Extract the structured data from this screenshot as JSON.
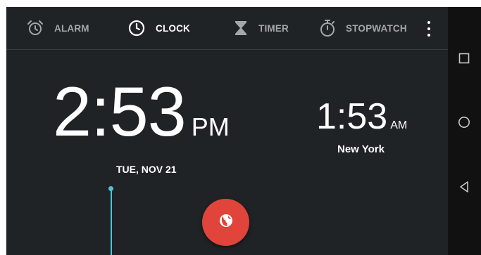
{
  "tabs": [
    {
      "label": "ALARM",
      "icon": "alarm-clock-icon",
      "active": false
    },
    {
      "label": "CLOCK",
      "icon": "clock-icon",
      "active": true
    },
    {
      "label": "TIMER",
      "icon": "hourglass-icon",
      "active": false
    },
    {
      "label": "STOPWATCH",
      "icon": "stopwatch-icon",
      "active": false
    }
  ],
  "overflow_menu_icon": "more-vert-icon",
  "main_clock": {
    "time": "2:53",
    "ampm": "PM",
    "date": "TUE, NOV 21"
  },
  "world_clock": {
    "time": "1:53",
    "ampm": "AM",
    "city": "New York"
  },
  "fab": {
    "icon": "globe-icon",
    "color": "#e0443a"
  },
  "nav": {
    "recent_icon": "recent-apps-icon",
    "home_icon": "home-icon",
    "back_icon": "back-icon"
  },
  "colors": {
    "background": "#202326",
    "accent": "#4fc3d7",
    "fab": "#e0443a",
    "inactive_tab": "#a4a7aa"
  }
}
